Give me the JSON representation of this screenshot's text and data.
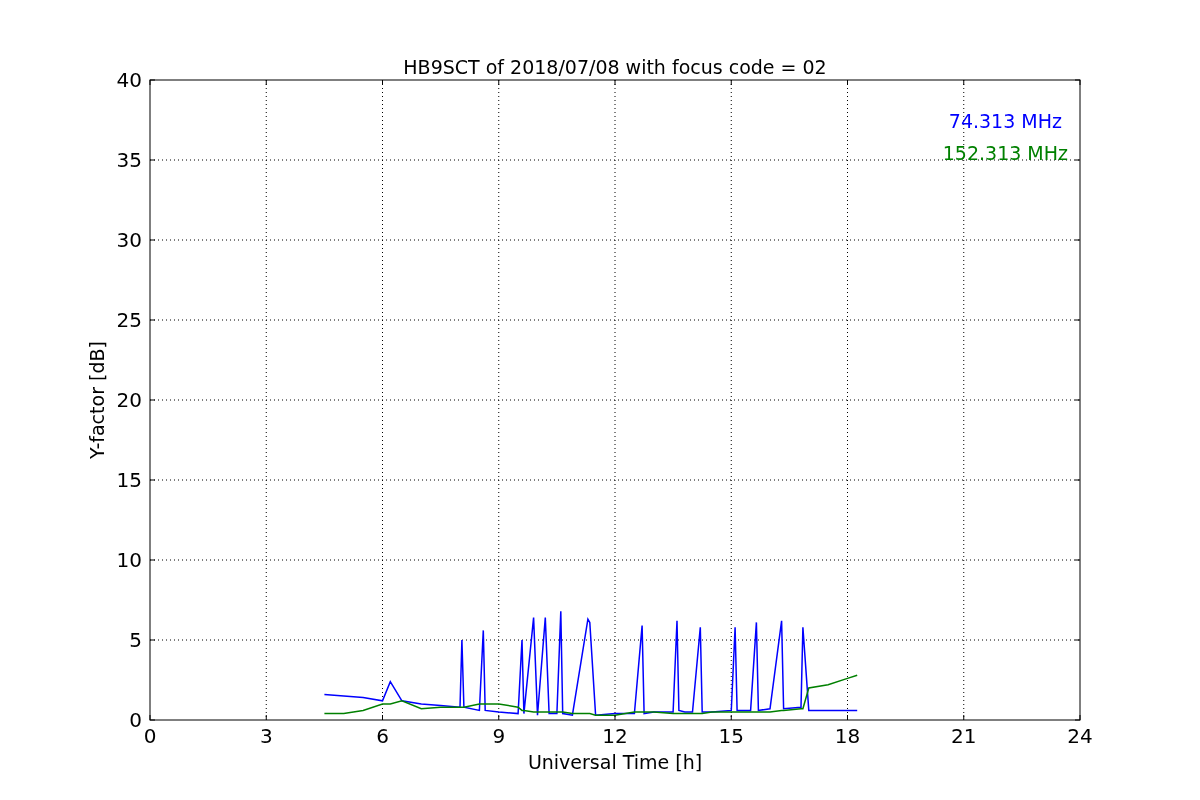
{
  "figure": {
    "chart_data": {
      "type": "line",
      "title": "HB9SCT of 2018/07/08 with focus code = 02",
      "xlabel": "Universal Time [h]",
      "ylabel": "Y-factor [dB]",
      "grid": true,
      "xlim": [
        0,
        24
      ],
      "ylim": [
        0,
        40
      ],
      "xticks": [
        0,
        3,
        6,
        9,
        12,
        15,
        18,
        21,
        24
      ],
      "yticks": [
        0,
        5,
        10,
        15,
        20,
        25,
        30,
        35,
        40
      ],
      "x": [
        4.5,
        5,
        5.5,
        6,
        6.2,
        6.5,
        7,
        7.5,
        8,
        8.05,
        8.1,
        8.5,
        8.6,
        8.65,
        9,
        9.5,
        9.6,
        9.65,
        9.9,
        10,
        10.2,
        10.3,
        10.5,
        10.6,
        10.65,
        10.9,
        11.3,
        11.35,
        11.5,
        12,
        12.5,
        12.7,
        12.75,
        13,
        13.5,
        13.6,
        13.65,
        13.8,
        14,
        14.2,
        14.25,
        14.5,
        15,
        15.1,
        15.15,
        15.5,
        15.65,
        15.7,
        16,
        16.3,
        16.35,
        16.8,
        16.85,
        17,
        17.5,
        18,
        18.25
      ],
      "series": [
        {
          "name": "74.313 MHz",
          "color": "#0000ff",
          "values": [
            1.6,
            1.5,
            1.4,
            1.2,
            2.4,
            1.2,
            1.0,
            0.9,
            0.8,
            5.0,
            0.8,
            0.6,
            5.6,
            0.6,
            0.5,
            0.4,
            5.0,
            0.4,
            6.4,
            0.3,
            6.4,
            0.4,
            0.4,
            6.8,
            0.4,
            0.3,
            6.3,
            6.1,
            0.3,
            0.4,
            0.4,
            5.9,
            0.4,
            0.5,
            0.5,
            6.2,
            0.6,
            0.5,
            0.5,
            5.8,
            0.5,
            0.5,
            0.6,
            5.8,
            0.6,
            0.6,
            6.1,
            0.6,
            0.7,
            6.2,
            0.7,
            0.8,
            5.8,
            0.6,
            0.6,
            0.6,
            0.6
          ]
        },
        {
          "name": "152.313 MHz",
          "color": "#008000",
          "values": [
            0.4,
            0.4,
            0.6,
            1.0,
            1.0,
            1.2,
            0.7,
            0.8,
            0.8,
            0.8,
            0.8,
            1.0,
            1.0,
            1.0,
            1.0,
            0.8,
            0.6,
            0.6,
            0.5,
            0.5,
            0.5,
            0.5,
            0.5,
            0.5,
            0.5,
            0.4,
            0.4,
            0.4,
            0.3,
            0.3,
            0.5,
            0.5,
            0.5,
            0.5,
            0.4,
            0.4,
            0.4,
            0.4,
            0.4,
            0.4,
            0.4,
            0.5,
            0.5,
            0.5,
            0.5,
            0.5,
            0.5,
            0.5,
            0.5,
            0.6,
            0.6,
            0.7,
            0.7,
            2.0,
            2.2,
            2.6,
            2.8
          ]
        }
      ]
    }
  }
}
